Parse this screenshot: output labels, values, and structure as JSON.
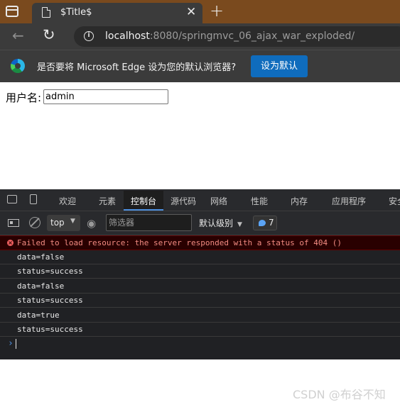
{
  "browser": {
    "tab_title": "$Title$",
    "tab_close": "✕",
    "new_tab": "+",
    "url_host": "localhost",
    "url_rest": ":8080/springmvc_06_ajax_war_exploded/",
    "back_glyph": "←",
    "refresh_glyph": "↻"
  },
  "infobar": {
    "message": "是否要将 Microsoft Edge 设为您的默认浏览器?",
    "button_label": "设为默认"
  },
  "page": {
    "username_label": "用户名:",
    "username_value": "admin"
  },
  "devtools": {
    "tabs": [
      "欢迎",
      "元素",
      "控制台",
      "源代码",
      "网络",
      "性能",
      "内存",
      "应用程序",
      "安全"
    ],
    "active_tab": "控制台",
    "context_select": "top",
    "filter_placeholder": "筛选器",
    "log_level": "默认级别",
    "message_count": "7",
    "error_message": "Failed to load resource: the server responded with a status of 404 ()",
    "logs": [
      "data=false",
      "status=success",
      "data=false",
      "status=success",
      "data=true",
      "status=success"
    ],
    "prompt": "›"
  },
  "watermark": "CSDN @布谷不知",
  "colors": {
    "tabstrip": "#7a4a1e",
    "chrome": "#3b3b3b",
    "accent_button": "#0f6cbd",
    "devtools_bg": "#202124",
    "error_bg": "#290000",
    "error_text": "#f28b82"
  },
  "icons": [
    "tab-actions-icon",
    "page-favicon-icon",
    "close-icon",
    "plus-icon",
    "back-arrow-icon",
    "refresh-icon",
    "info-icon",
    "edge-logo-icon",
    "inspect-icon",
    "device-toolbar-icon",
    "dock-icon",
    "clear-console-icon",
    "eye-icon",
    "message-icon",
    "error-icon"
  ]
}
